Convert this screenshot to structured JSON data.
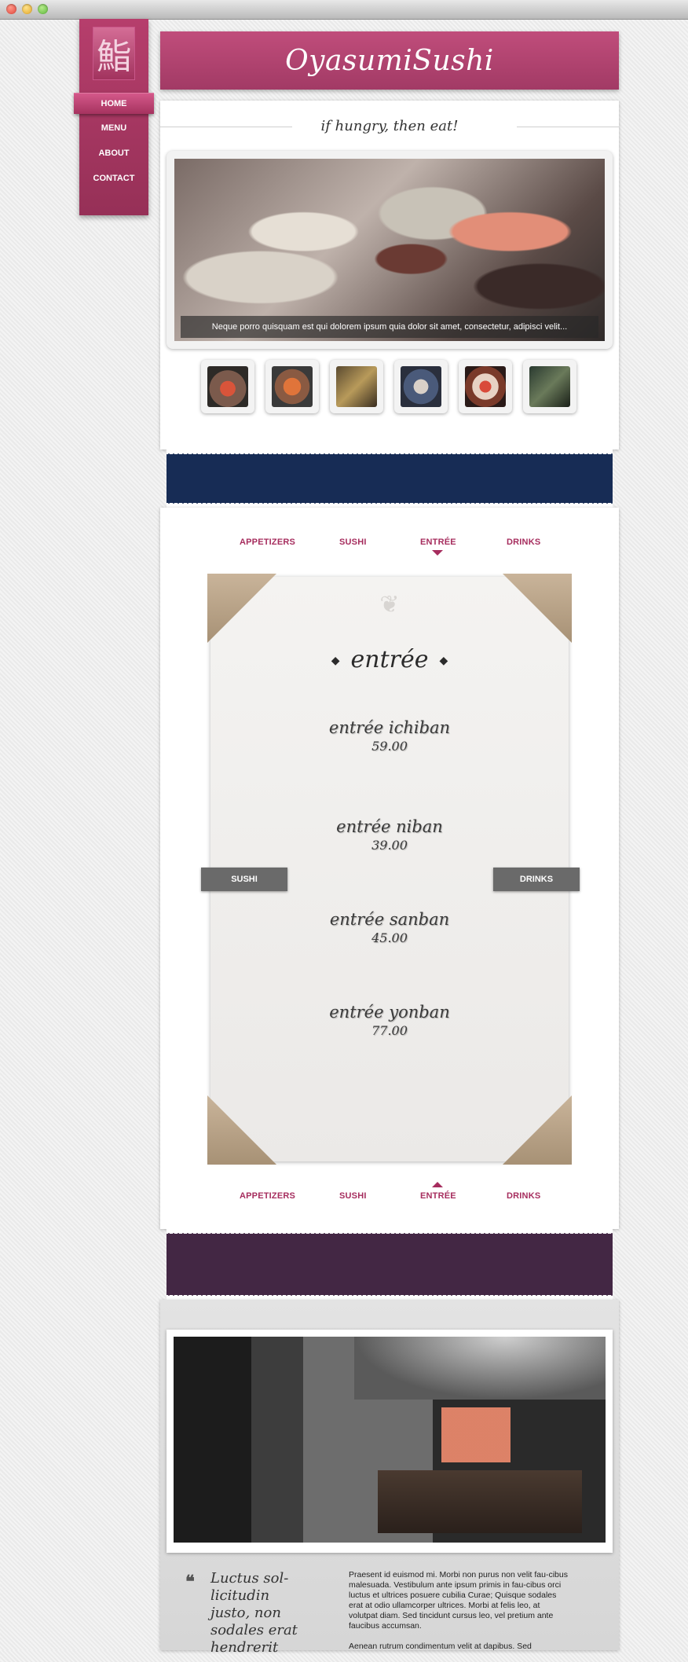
{
  "nav": {
    "logo_glyph": "鮨",
    "items": [
      {
        "label": "HOME",
        "active": true
      },
      {
        "label": "MENU",
        "active": false
      },
      {
        "label": "ABOUT",
        "active": false
      },
      {
        "label": "CONTACT",
        "active": false
      }
    ]
  },
  "header": {
    "title": "OyasumiSushi",
    "tagline": "if hungry, then eat!"
  },
  "slider": {
    "caption": "Neque porro quisquam est qui dolorem ipsum quia dolor sit amet, consectetur, adipisci velit..."
  },
  "menu": {
    "tabs": [
      "APPETIZERS",
      "SUSHI",
      "ENTRÉE",
      "DRINKS"
    ],
    "active_tab": "ENTRÉE",
    "heading": "entrée",
    "items": [
      {
        "name": "entrée ichiban",
        "price": "59.00"
      },
      {
        "name": "entrée niban",
        "price": "39.00"
      },
      {
        "name": "entrée sanban",
        "price": "45.00"
      },
      {
        "name": "entrée yonban",
        "price": "77.00"
      }
    ],
    "prev_button": "SUSHI",
    "next_button": "DRINKS"
  },
  "about": {
    "quote": "Luctus sol-licitudin justo, non sodales erat hendrerit",
    "paragraph1": "Praesent id euismod mi. Morbi non purus non velit fau-cibus malesuada. Vestibulum ante ipsum primis in fau-cibus orci luctus et ultrices posuere cubilia Curae; Quisque sodales erat at odio ullamcorper ultrices. Morbi at felis leo, at volutpat diam. Sed tincidunt cursus leo, vel pretium ante faucibus accumsan.",
    "paragraph2": "Aenean rutrum condimentum velit at dapibus. Sed"
  },
  "colors": {
    "brand": "#a62d5e",
    "band_blue": "#172c55",
    "band_purple": "#432744"
  }
}
